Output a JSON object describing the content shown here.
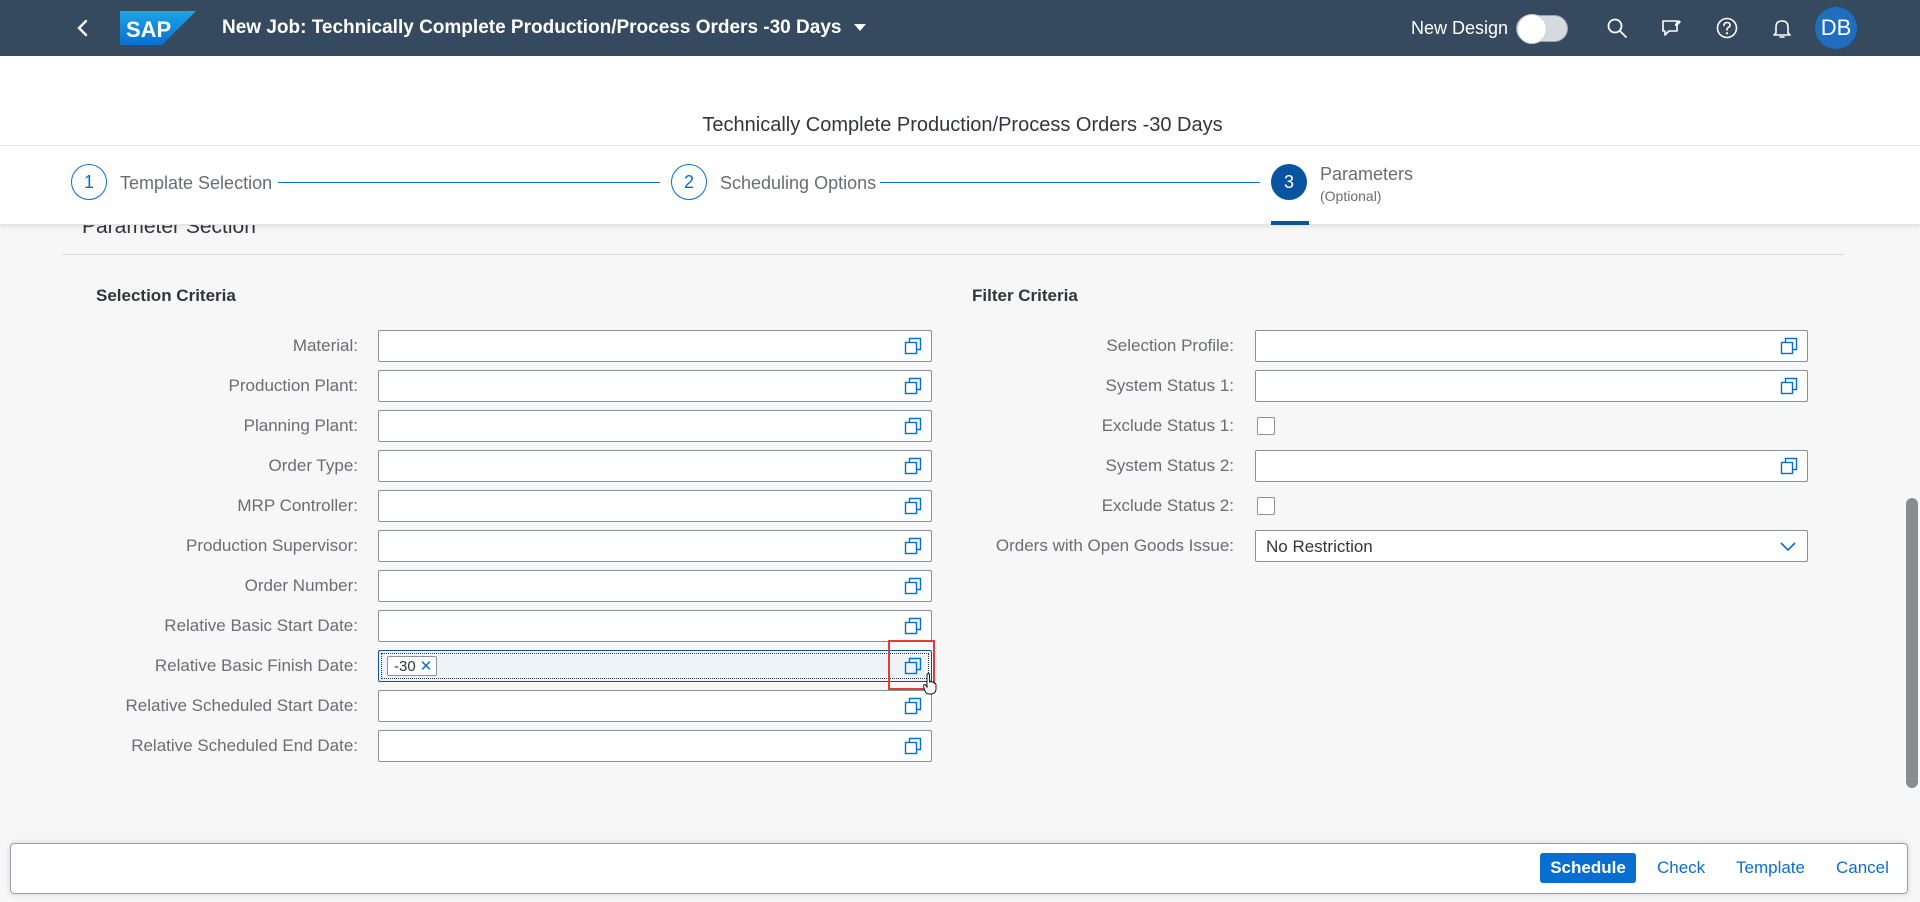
{
  "shell": {
    "title": "New Job: Technically Complete Production/Process Orders -30 Days",
    "new_design_label": "New Design",
    "avatar_initials": "DB",
    "logo_text": "SAP",
    "brand_color": "#354a5f",
    "icons": [
      "back-icon",
      "search-icon",
      "feedback-icon",
      "help-icon",
      "notification-bell-icon"
    ]
  },
  "page": {
    "title": "Technically Complete Production/Process Orders -30 Days"
  },
  "wizard": {
    "steps": [
      {
        "number": "1",
        "label": "Template Selection",
        "sub": ""
      },
      {
        "number": "2",
        "label": "Scheduling Options",
        "sub": ""
      },
      {
        "number": "3",
        "label": "Parameters",
        "sub": "(Optional)"
      }
    ],
    "active_step": 3
  },
  "section": {
    "title": "Parameter Section"
  },
  "selection_criteria": {
    "title": "Selection Criteria",
    "fields": [
      {
        "label": "Material:",
        "value": ""
      },
      {
        "label": "Production Plant:",
        "value": ""
      },
      {
        "label": "Planning Plant:",
        "value": ""
      },
      {
        "label": "Order Type:",
        "value": ""
      },
      {
        "label": "MRP Controller:",
        "value": ""
      },
      {
        "label": "Production Supervisor:",
        "value": ""
      },
      {
        "label": "Order Number:",
        "value": ""
      },
      {
        "label": "Relative Basic Start Date:",
        "value": ""
      },
      {
        "label": "Relative Basic Finish Date:",
        "value": "",
        "token": "-30"
      },
      {
        "label": "Relative Scheduled Start Date:",
        "value": ""
      },
      {
        "label": "Relative Scheduled End Date:",
        "value": ""
      }
    ]
  },
  "filter_criteria": {
    "title": "Filter Criteria",
    "selection_profile": {
      "label": "Selection Profile:",
      "value": ""
    },
    "system_status_1": {
      "label": "System Status 1:",
      "value": ""
    },
    "exclude_status_1": {
      "label": "Exclude Status 1:",
      "checked": false
    },
    "system_status_2": {
      "label": "System Status 2:",
      "value": ""
    },
    "exclude_status_2": {
      "label": "Exclude Status 2:",
      "checked": false
    },
    "open_goods_issue": {
      "label": "Orders with Open Goods Issue:",
      "value": "No Restriction"
    }
  },
  "footer": {
    "schedule": "Schedule",
    "check": "Check",
    "template": "Template",
    "cancel": "Cancel"
  }
}
